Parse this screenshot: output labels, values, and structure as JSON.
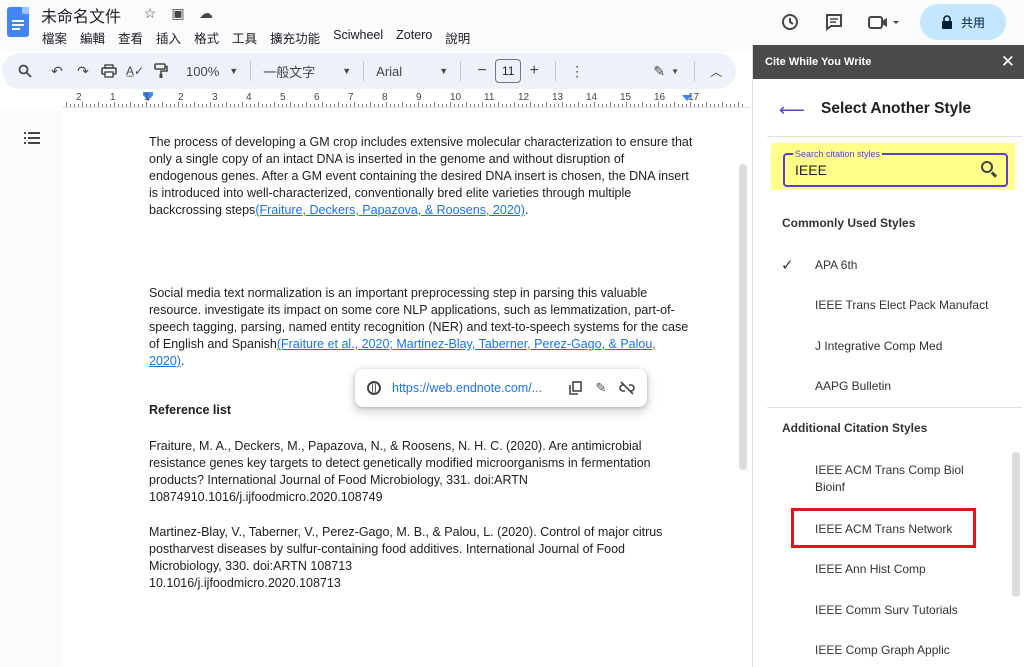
{
  "header": {
    "doc_title": "未命名文件",
    "menu": [
      "檔案",
      "編輯",
      "查看",
      "插入",
      "格式",
      "工具",
      "擴充功能",
      "Sciwheel",
      "Zotero",
      "說明"
    ],
    "share_label": "共用"
  },
  "toolbar": {
    "zoom": "100%",
    "style": "一般文字",
    "font": "Arial",
    "font_size": "11"
  },
  "ruler": {
    "numbers": [
      "2",
      "1",
      "1",
      "2",
      "3",
      "4",
      "5",
      "6",
      "7",
      "8",
      "9",
      "10",
      "11",
      "12",
      "13",
      "14",
      "15",
      "16",
      "17"
    ]
  },
  "document": {
    "para1_text": "The process of developing a GM crop includes extensive molecular characterization to ensure that only a single copy of an intact DNA is inserted in the genome and without disruption of endogenous genes. After a GM event containing the desired DNA insert is chosen, the DNA insert is introduced into well-characterized, conventionally bred elite varieties through multiple backcrossing steps",
    "para1_cite": "(Fraiture, Deckers, Papazova, & Roosens, 2020)",
    "para1_end": ".",
    "para2_text": "Social media text normalization is an important preprocessing step in parsing this valuable resource. investigate its impact on some core NLP applications, such as lemmatization, part-of-speech tagging, parsing, named entity recognition (NER) and text-to-speech systems for the case of English and Spanish",
    "para2_cite": "(Fraiture et al., 2020; Martinez-Blay, Taberner, Perez-Gago, & Palou, 2020)",
    "para2_end": ".",
    "ref_heading": "Reference list",
    "ref1": "Fraiture, M. A., Deckers, M., Papazova, N., & Roosens, N. H. C. (2020). Are antimicrobial resistance genes key targets to detect genetically modified microorganisms in fermentation products? International Journal of Food Microbiology, 331. doi:ARTN 10874910.1016/j.ijfoodmicro.2020.108749",
    "ref2": "Martinez-Blay, V., Taberner, V., Perez-Gago, M. B., & Palou, L. (2020). Control of major citrus postharvest diseases by sulfur-containing food additives. International Journal of Food Microbiology, 330. doi:ARTN 108713\n10.1016/j.ijfoodmicro.2020.108713"
  },
  "link_popup": {
    "url": "https://web.endnote.com/..."
  },
  "panel": {
    "header_title": "Cite While You Write",
    "title": "Select Another Style",
    "search_label": "Search citation styles",
    "search_value": "IEEE",
    "common_heading": "Commonly Used Styles",
    "common_styles": [
      "APA 6th",
      "IEEE Trans Elect Pack Manufact",
      "J Integrative Comp Med",
      "AAPG Bulletin"
    ],
    "additional_heading": "Additional Citation Styles",
    "additional_styles": [
      "IEEE ACM Trans Comp Biol Bioinf",
      "IEEE ACM Trans Network",
      "IEEE Ann Hist Comp",
      "IEEE Comm Surv Tutorials",
      "IEEE Comp Graph Applic"
    ]
  },
  "colors": {
    "accent_purple": "#5b3fd1",
    "highlight_yellow": "#ffff8a",
    "selection_red": "#e0141e",
    "link_blue": "#1a73e8"
  }
}
